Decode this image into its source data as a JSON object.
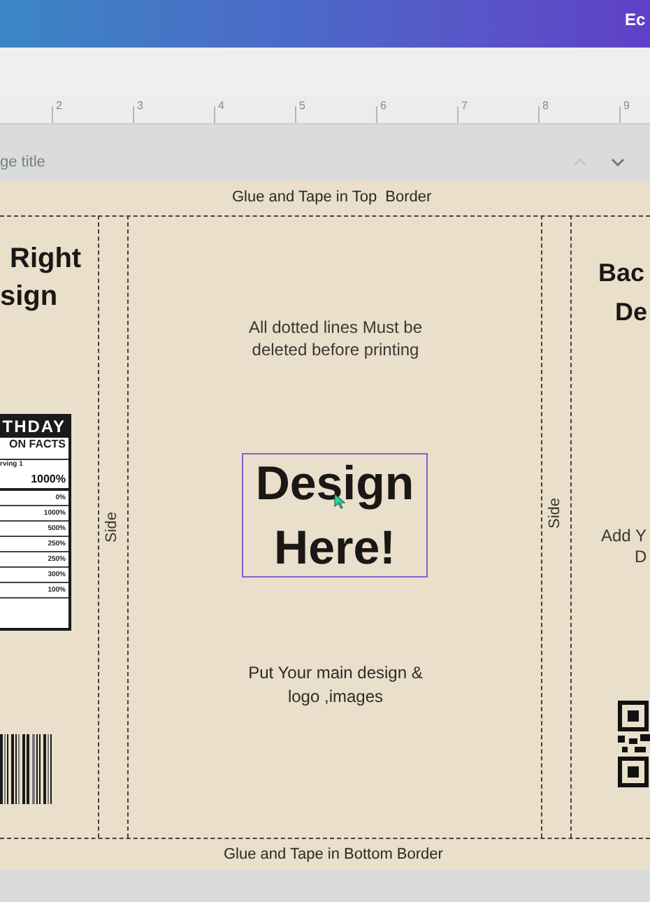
{
  "header": {
    "button_label": "Ec"
  },
  "ruler": {
    "marks": [
      "2",
      "3",
      "4",
      "5",
      "6",
      "7",
      "8",
      "9"
    ]
  },
  "page_bar": {
    "title_placeholder": "ge title"
  },
  "design": {
    "top_note": "Glue and Tape in Top  Border",
    "bottom_note": "Glue and Tape in Bottom Border",
    "side_labels": [
      "Side",
      "Side"
    ],
    "front_panel": {
      "hint": "All dotted lines Must be deleted before printing",
      "headline": "Design Here!",
      "selected": true,
      "footer": "Put Your main design & logo ,images"
    },
    "right_panel": {
      "title_lines": [
        "Right",
        "sign"
      ]
    },
    "back_panel": {
      "title_lines": [
        "Bac",
        "De"
      ],
      "hint_lines": [
        "Add Y",
        "D"
      ]
    },
    "nutrition_label": {
      "title": "THDAY",
      "subtitle": "ON FACTS",
      "serving": "rving 1",
      "total": "1000%",
      "rows": [
        {
          "value": "0%"
        },
        {
          "value": "1000%"
        },
        {
          "value": "500%"
        },
        {
          "value": "250%"
        },
        {
          "value": "250%"
        },
        {
          "value": "300%"
        },
        {
          "value": "100%"
        }
      ]
    }
  }
}
